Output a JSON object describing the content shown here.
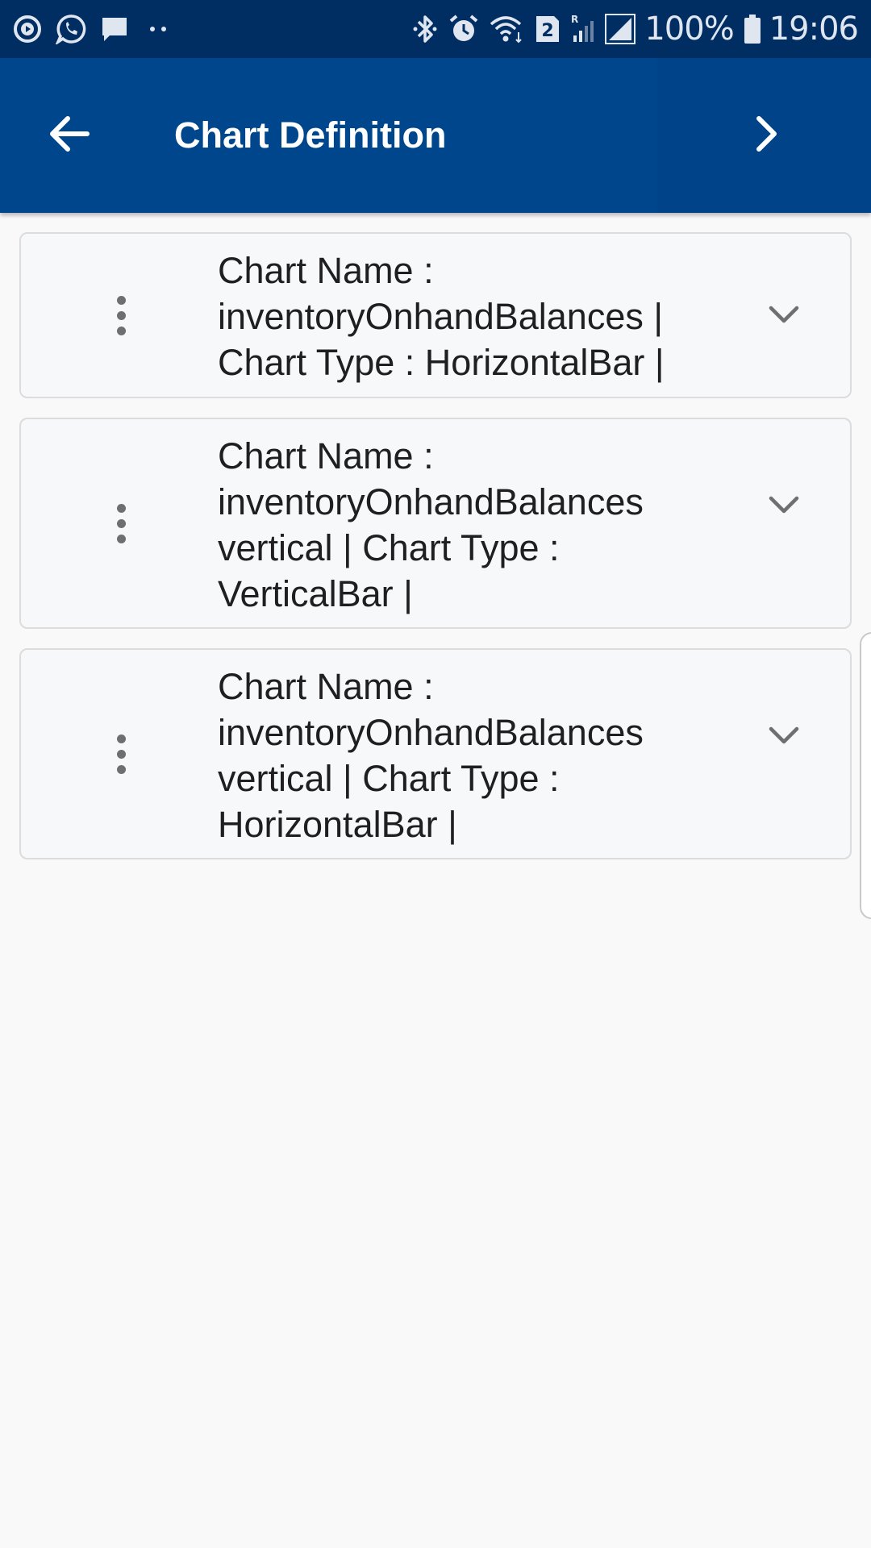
{
  "status_bar": {
    "left_icons": [
      "play-circle-icon",
      "whatsapp-icon",
      "message-icon",
      "more-dots-icon"
    ],
    "right_icons": [
      "bluetooth-icon",
      "alarm-icon",
      "wifi-icon",
      "sim-2-icon",
      "roaming-signal-icon",
      "signal-icon"
    ],
    "sim_label": "2",
    "roaming_label": "R",
    "battery": "100%",
    "time": "19:06"
  },
  "header": {
    "title": "Chart Definition",
    "back_icon": "arrow-left-icon",
    "next_icon": "chevron-right-icon"
  },
  "charts": [
    {
      "text": "Chart Name : inventoryOnhandBalances | Chart Type : HorizontalBar |",
      "lines": [
        "Chart Name :",
        "inventoryOnhandBalances |",
        "Chart Type : HorizontalBar |"
      ]
    },
    {
      "text": "Chart Name : inventoryOnhandBalances vertical | Chart Type : VerticalBar |",
      "lines": [
        "Chart Name :",
        "inventoryOnhandBalances",
        "vertical | Chart Type :",
        "VerticalBar |"
      ]
    },
    {
      "text": "Chart Name : inventoryOnhandBalances vertical | Chart Type : HorizontalBar |",
      "lines": [
        "Chart Name :",
        "inventoryOnhandBalances",
        "vertical | Chart Type :",
        "HorizontalBar |"
      ]
    }
  ],
  "colors": {
    "status_bar": "#002e63",
    "app_bar": "#00468c",
    "background": "#f9f9fa",
    "card_border": "#dcdcdf",
    "text": "#1f1f22",
    "icon_gray": "#6f6f72"
  }
}
